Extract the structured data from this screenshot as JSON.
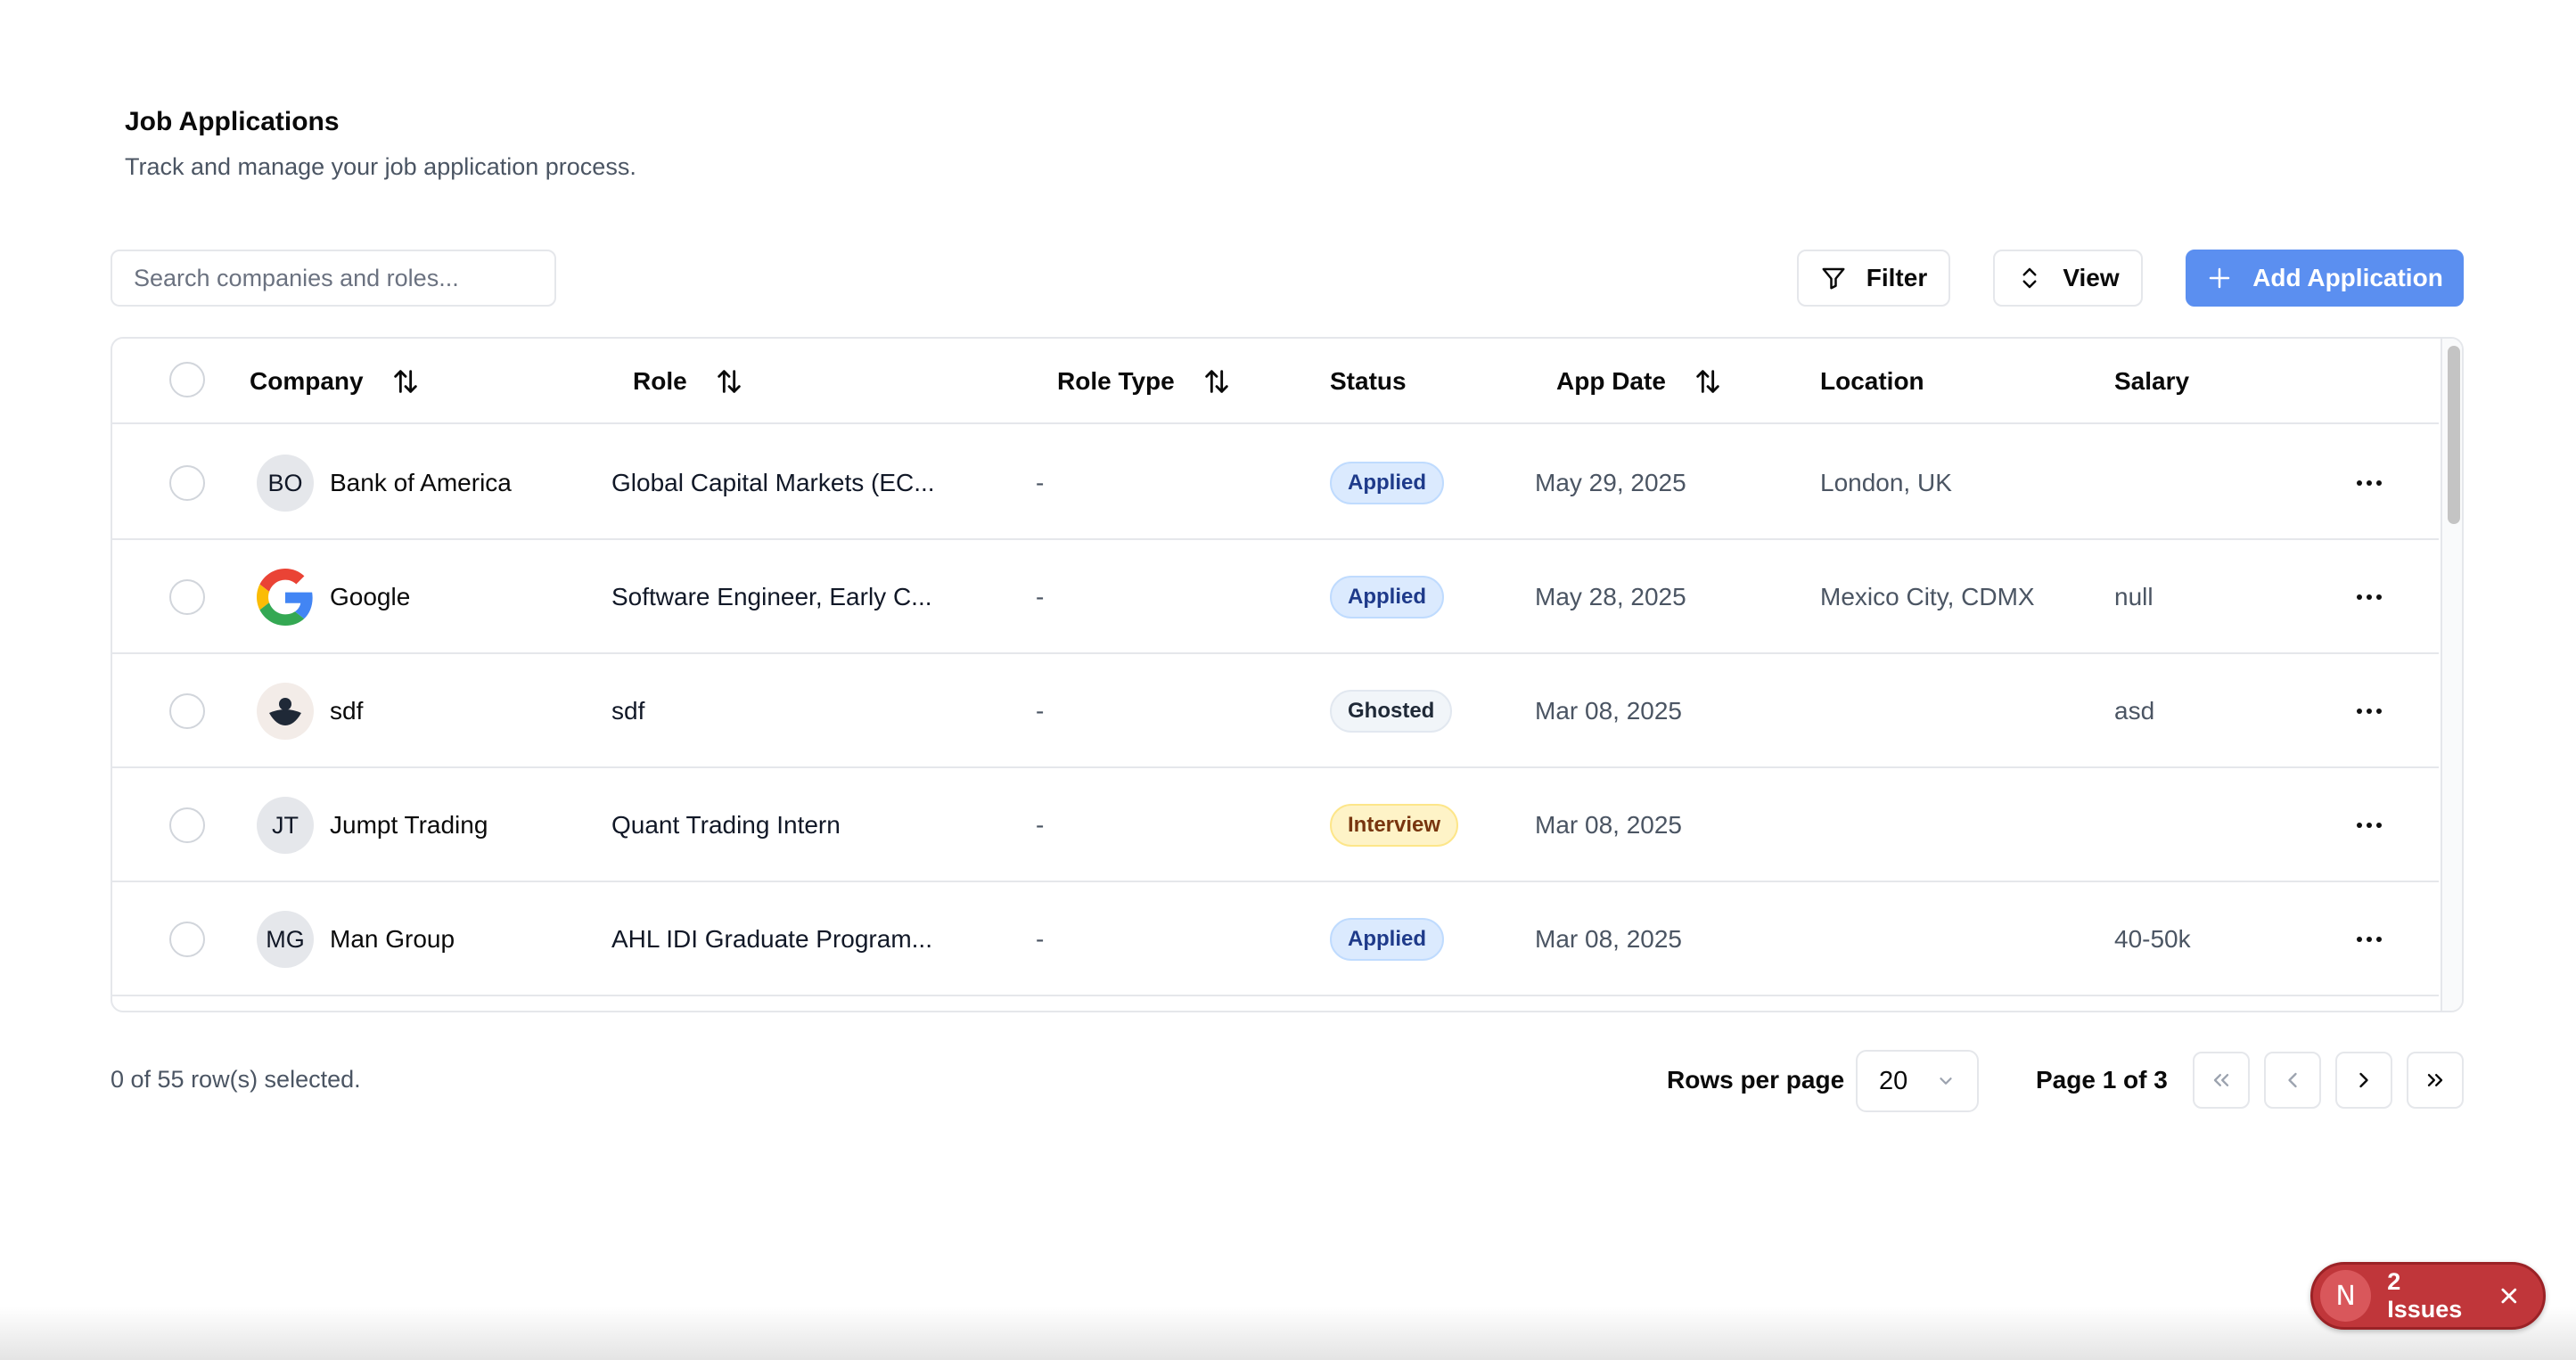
{
  "header": {
    "title": "Job Applications",
    "subtitle": "Track and manage your job application process."
  },
  "toolbar": {
    "search_placeholder": "Search companies and roles...",
    "filter_label": "Filter",
    "view_label": "View",
    "add_label": "Add Application",
    "accent_color": "#5b8ff0"
  },
  "table": {
    "columns": [
      "Company",
      "Role",
      "Role Type",
      "Status",
      "App Date",
      "Location",
      "Salary"
    ],
    "rows": [
      {
        "avatar": "BO",
        "avatar_kind": "initials",
        "company": "Bank of America",
        "role": "Global Capital Markets (EC...",
        "role_type": "-",
        "status": "Applied",
        "status_kind": "applied",
        "app_date": "May 29, 2025",
        "location": "London, UK",
        "salary": ""
      },
      {
        "avatar": "",
        "avatar_kind": "google-logo-icon",
        "company": "Google",
        "role": "Software Engineer, Early C...",
        "role_type": "-",
        "status": "Applied",
        "status_kind": "applied",
        "app_date": "May 28, 2025",
        "location": "Mexico City, CDMX",
        "salary": "null"
      },
      {
        "avatar": "",
        "avatar_kind": "bird-logo-icon",
        "company": "sdf",
        "role": "sdf",
        "role_type": "-",
        "status": "Ghosted",
        "status_kind": "ghosted",
        "app_date": "Mar 08, 2025",
        "location": "",
        "salary": "asd"
      },
      {
        "avatar": "JT",
        "avatar_kind": "initials",
        "company": "Jumpt Trading",
        "role": "Quant Trading Intern",
        "role_type": "-",
        "status": "Interview",
        "status_kind": "interview",
        "app_date": "Mar 08, 2025",
        "location": "",
        "salary": ""
      },
      {
        "avatar": "MG",
        "avatar_kind": "initials",
        "company": "Man Group",
        "role": "AHL IDI Graduate Program...",
        "role_type": "-",
        "status": "Applied",
        "status_kind": "applied",
        "app_date": "Mar 08, 2025",
        "location": "",
        "salary": "40-50k"
      }
    ]
  },
  "footer": {
    "selected_text": "0 of 55 row(s) selected.",
    "rows_per_page_label": "Rows per page",
    "rows_per_page_value": "20",
    "page_indicator": "Page 1 of 3"
  },
  "issues": {
    "logo": "N",
    "label": "2 Issues"
  }
}
